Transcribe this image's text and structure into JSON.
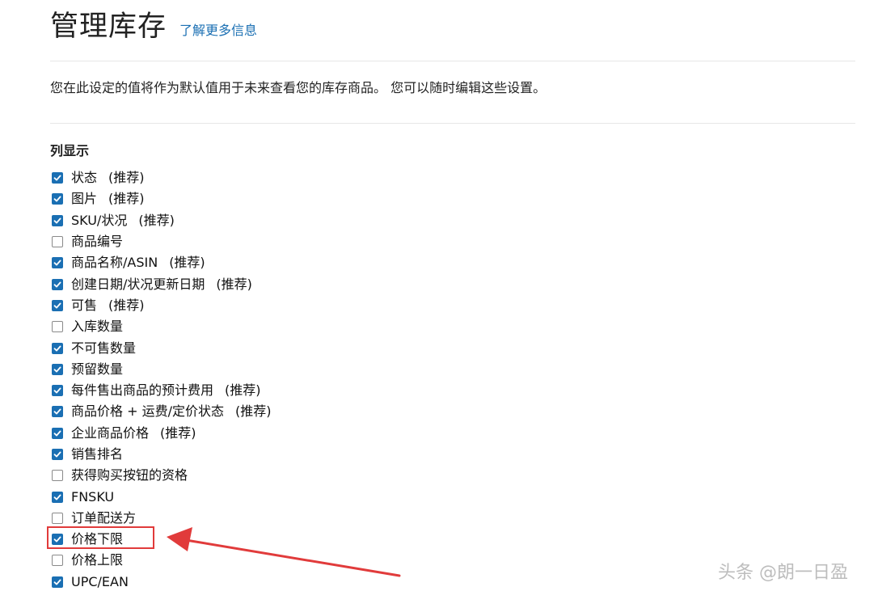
{
  "header": {
    "title": "管理库存",
    "learn_more": "了解更多信息"
  },
  "description": "您在此设定的值将作为默认值用于未来查看您的库存商品。 您可以随时编辑这些设置。",
  "columns_section": {
    "title": "列显示",
    "recommended_label": "(推荐)",
    "items": [
      {
        "label": "状态",
        "checked": true,
        "recommended": true
      },
      {
        "label": "图片",
        "checked": true,
        "recommended": true
      },
      {
        "label": "SKU/状况",
        "checked": true,
        "recommended": true
      },
      {
        "label": "商品编号",
        "checked": false,
        "recommended": false
      },
      {
        "label": "商品名称/ASIN",
        "checked": true,
        "recommended": true
      },
      {
        "label": "创建日期/状况更新日期",
        "checked": true,
        "recommended": true
      },
      {
        "label": "可售",
        "checked": true,
        "recommended": true
      },
      {
        "label": "入库数量",
        "checked": false,
        "recommended": false
      },
      {
        "label": "不可售数量",
        "checked": true,
        "recommended": false
      },
      {
        "label": "预留数量",
        "checked": true,
        "recommended": false
      },
      {
        "label": "每件售出商品的预计费用",
        "checked": true,
        "recommended": true
      },
      {
        "label": "商品价格 + 运费/定价状态",
        "checked": true,
        "recommended": true
      },
      {
        "label": "企业商品价格",
        "checked": true,
        "recommended": true
      },
      {
        "label": "销售排名",
        "checked": true,
        "recommended": false
      },
      {
        "label": "获得购买按钮的资格",
        "checked": false,
        "recommended": false
      },
      {
        "label": "FNSKU",
        "checked": true,
        "recommended": false
      },
      {
        "label": "订单配送方",
        "checked": false,
        "recommended": false
      },
      {
        "label": "价格下限",
        "checked": true,
        "recommended": false
      },
      {
        "label": "价格上限",
        "checked": false,
        "recommended": false
      },
      {
        "label": "UPC/EAN",
        "checked": true,
        "recommended": false
      }
    ]
  },
  "annotation": {
    "highlighted_item": "价格下限",
    "color": "#e13b3b"
  },
  "watermark": "头条 @朗一日盈",
  "colors": {
    "accent": "#1a6fb3",
    "checkbox_unchecked_border": "#8a8a8a"
  }
}
